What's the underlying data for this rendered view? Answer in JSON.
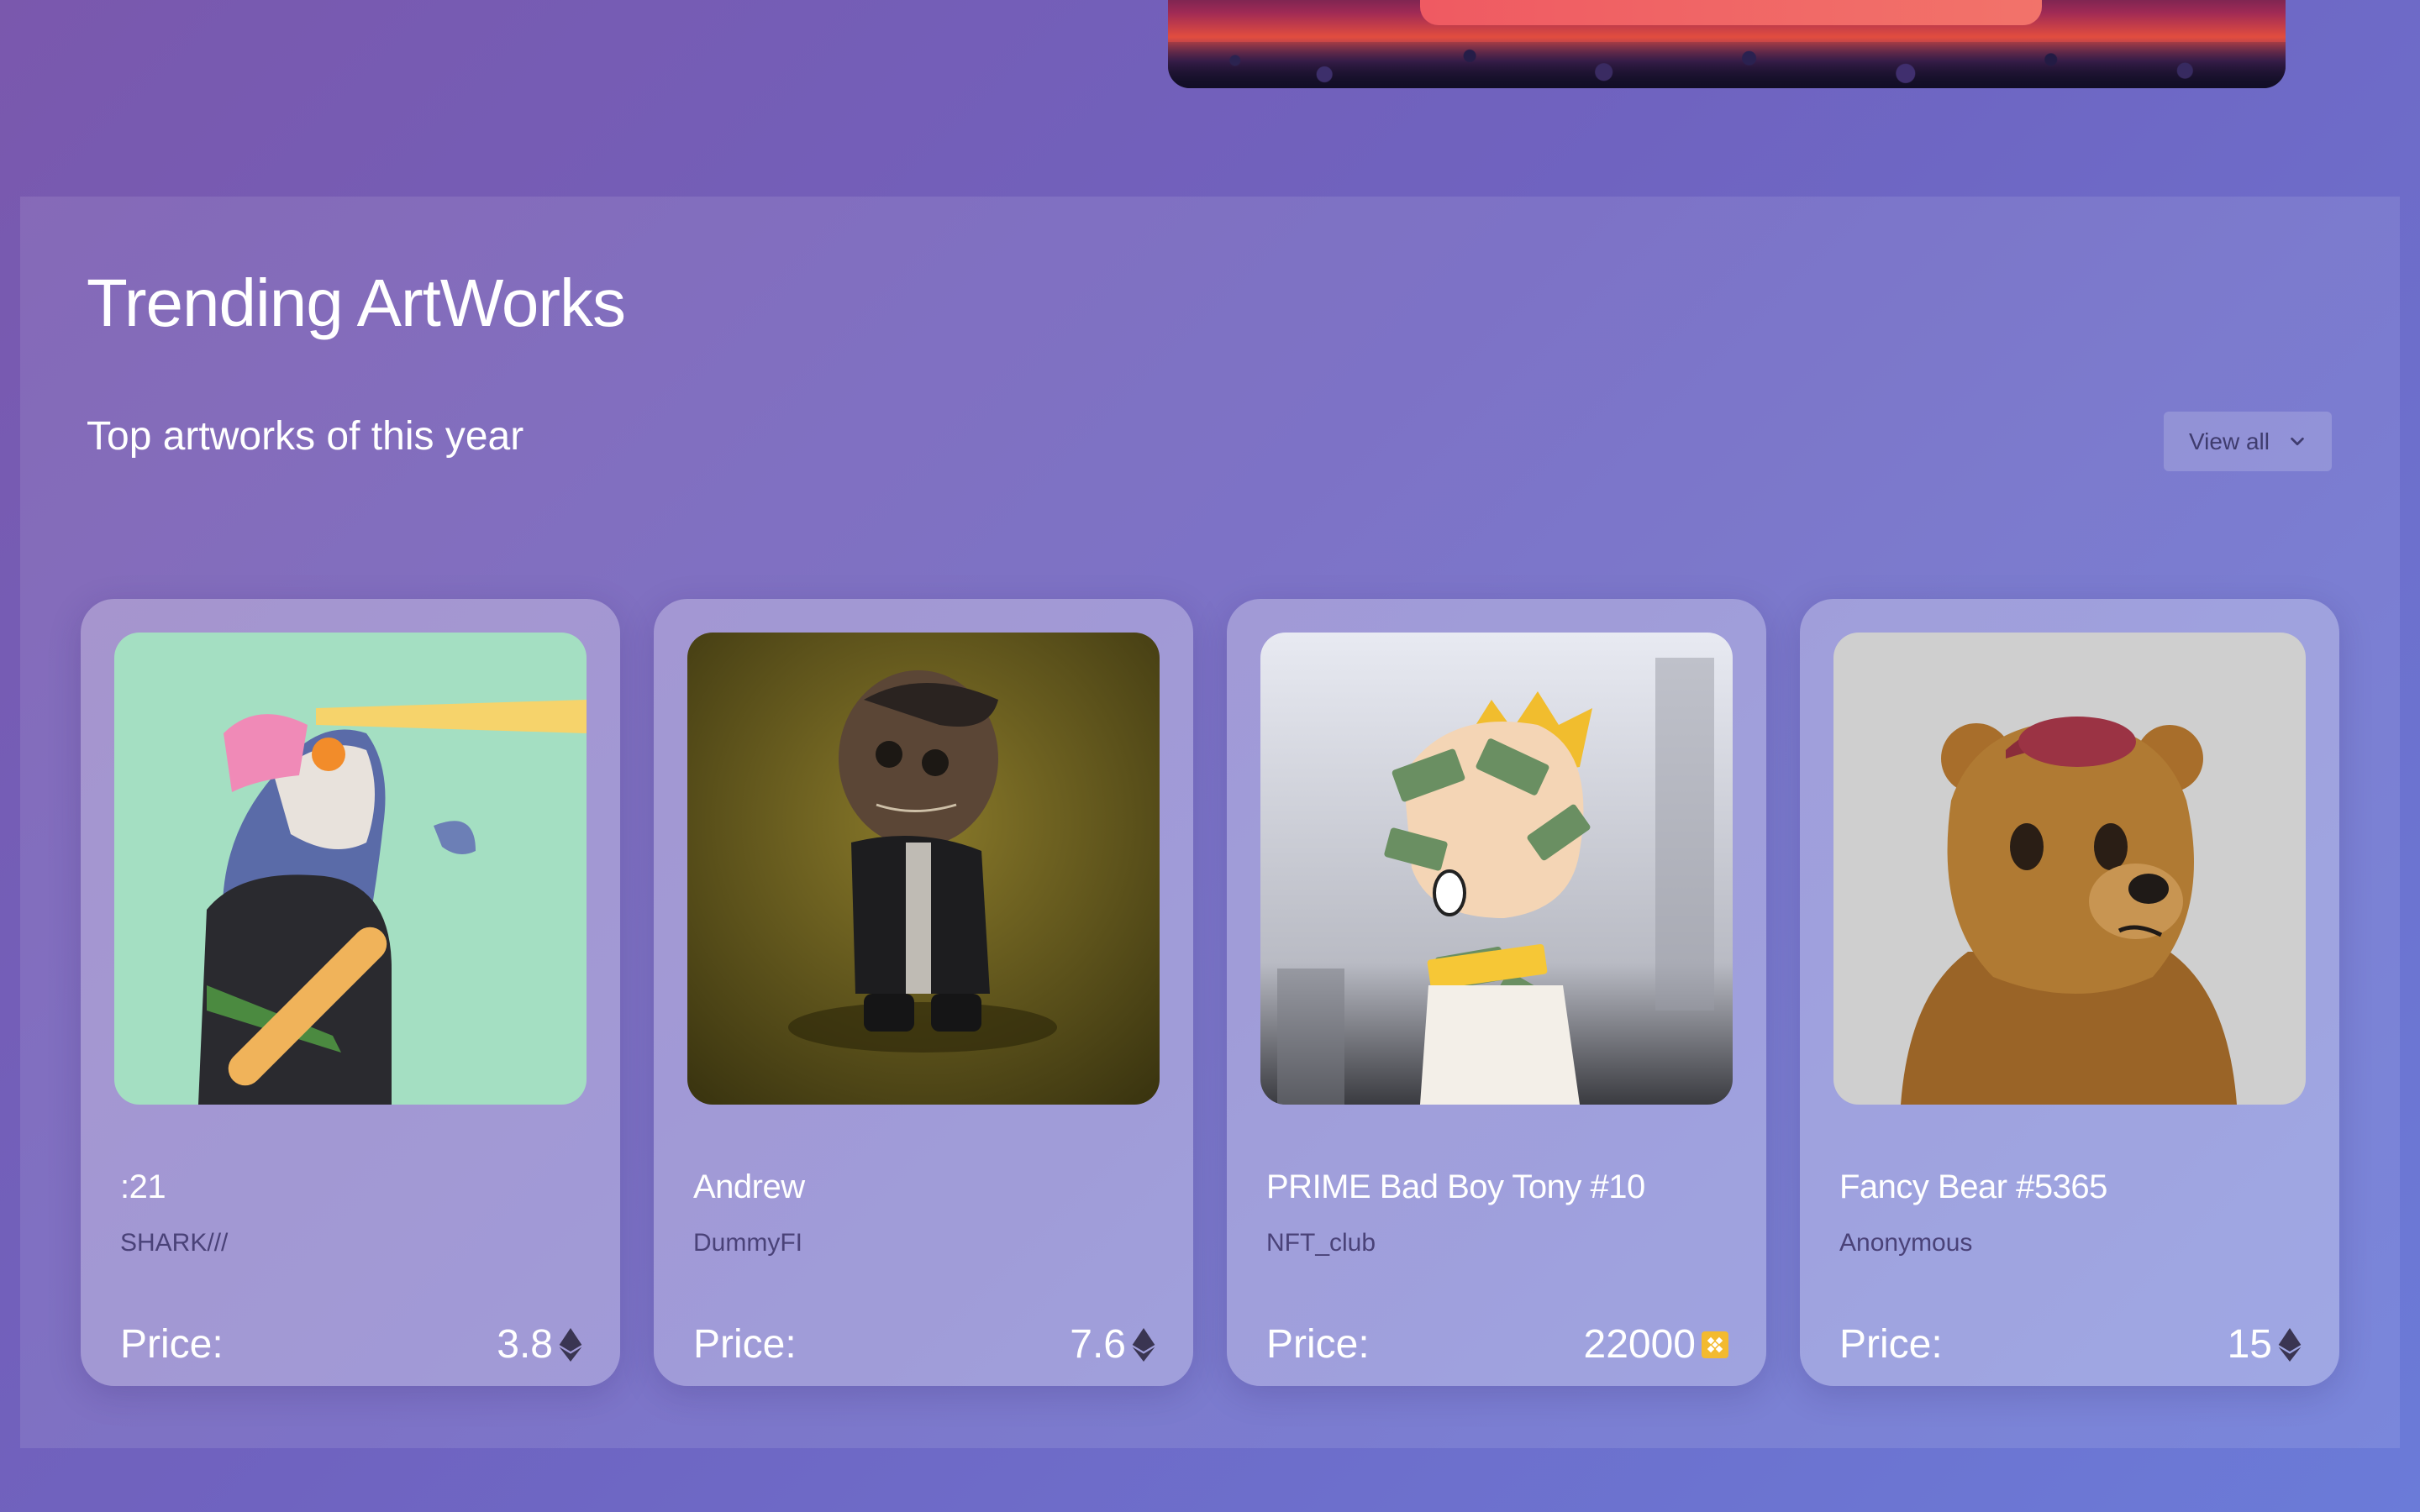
{
  "section": {
    "title": "Trending ArtWorks",
    "subtitle": "Top artworks of this year",
    "view_all_label": "View all"
  },
  "cards": [
    {
      "title": ":21",
      "owner": "SHARK///",
      "price_label": "Price:",
      "price": "3.8",
      "currency_icon": "ethereum-icon"
    },
    {
      "title": "Andrew",
      "owner": "DummyFI",
      "price_label": "Price:",
      "price": "7.6",
      "currency_icon": "ethereum-icon"
    },
    {
      "title": "PRIME Bad Boy Tony #10",
      "owner": "NFT_club",
      "price_label": "Price:",
      "price": "22000",
      "currency_icon": "bnb-icon"
    },
    {
      "title": "Fancy Bear #5365",
      "owner": "Anonymous",
      "price_label": "Price:",
      "price": "15",
      "currency_icon": "ethereum-icon"
    }
  ],
  "colors": {
    "background_start": "#7a58ad",
    "background_end": "#6b7bd8",
    "owner_text": "#4a4278",
    "bnb_accent": "#f3ba2f"
  }
}
